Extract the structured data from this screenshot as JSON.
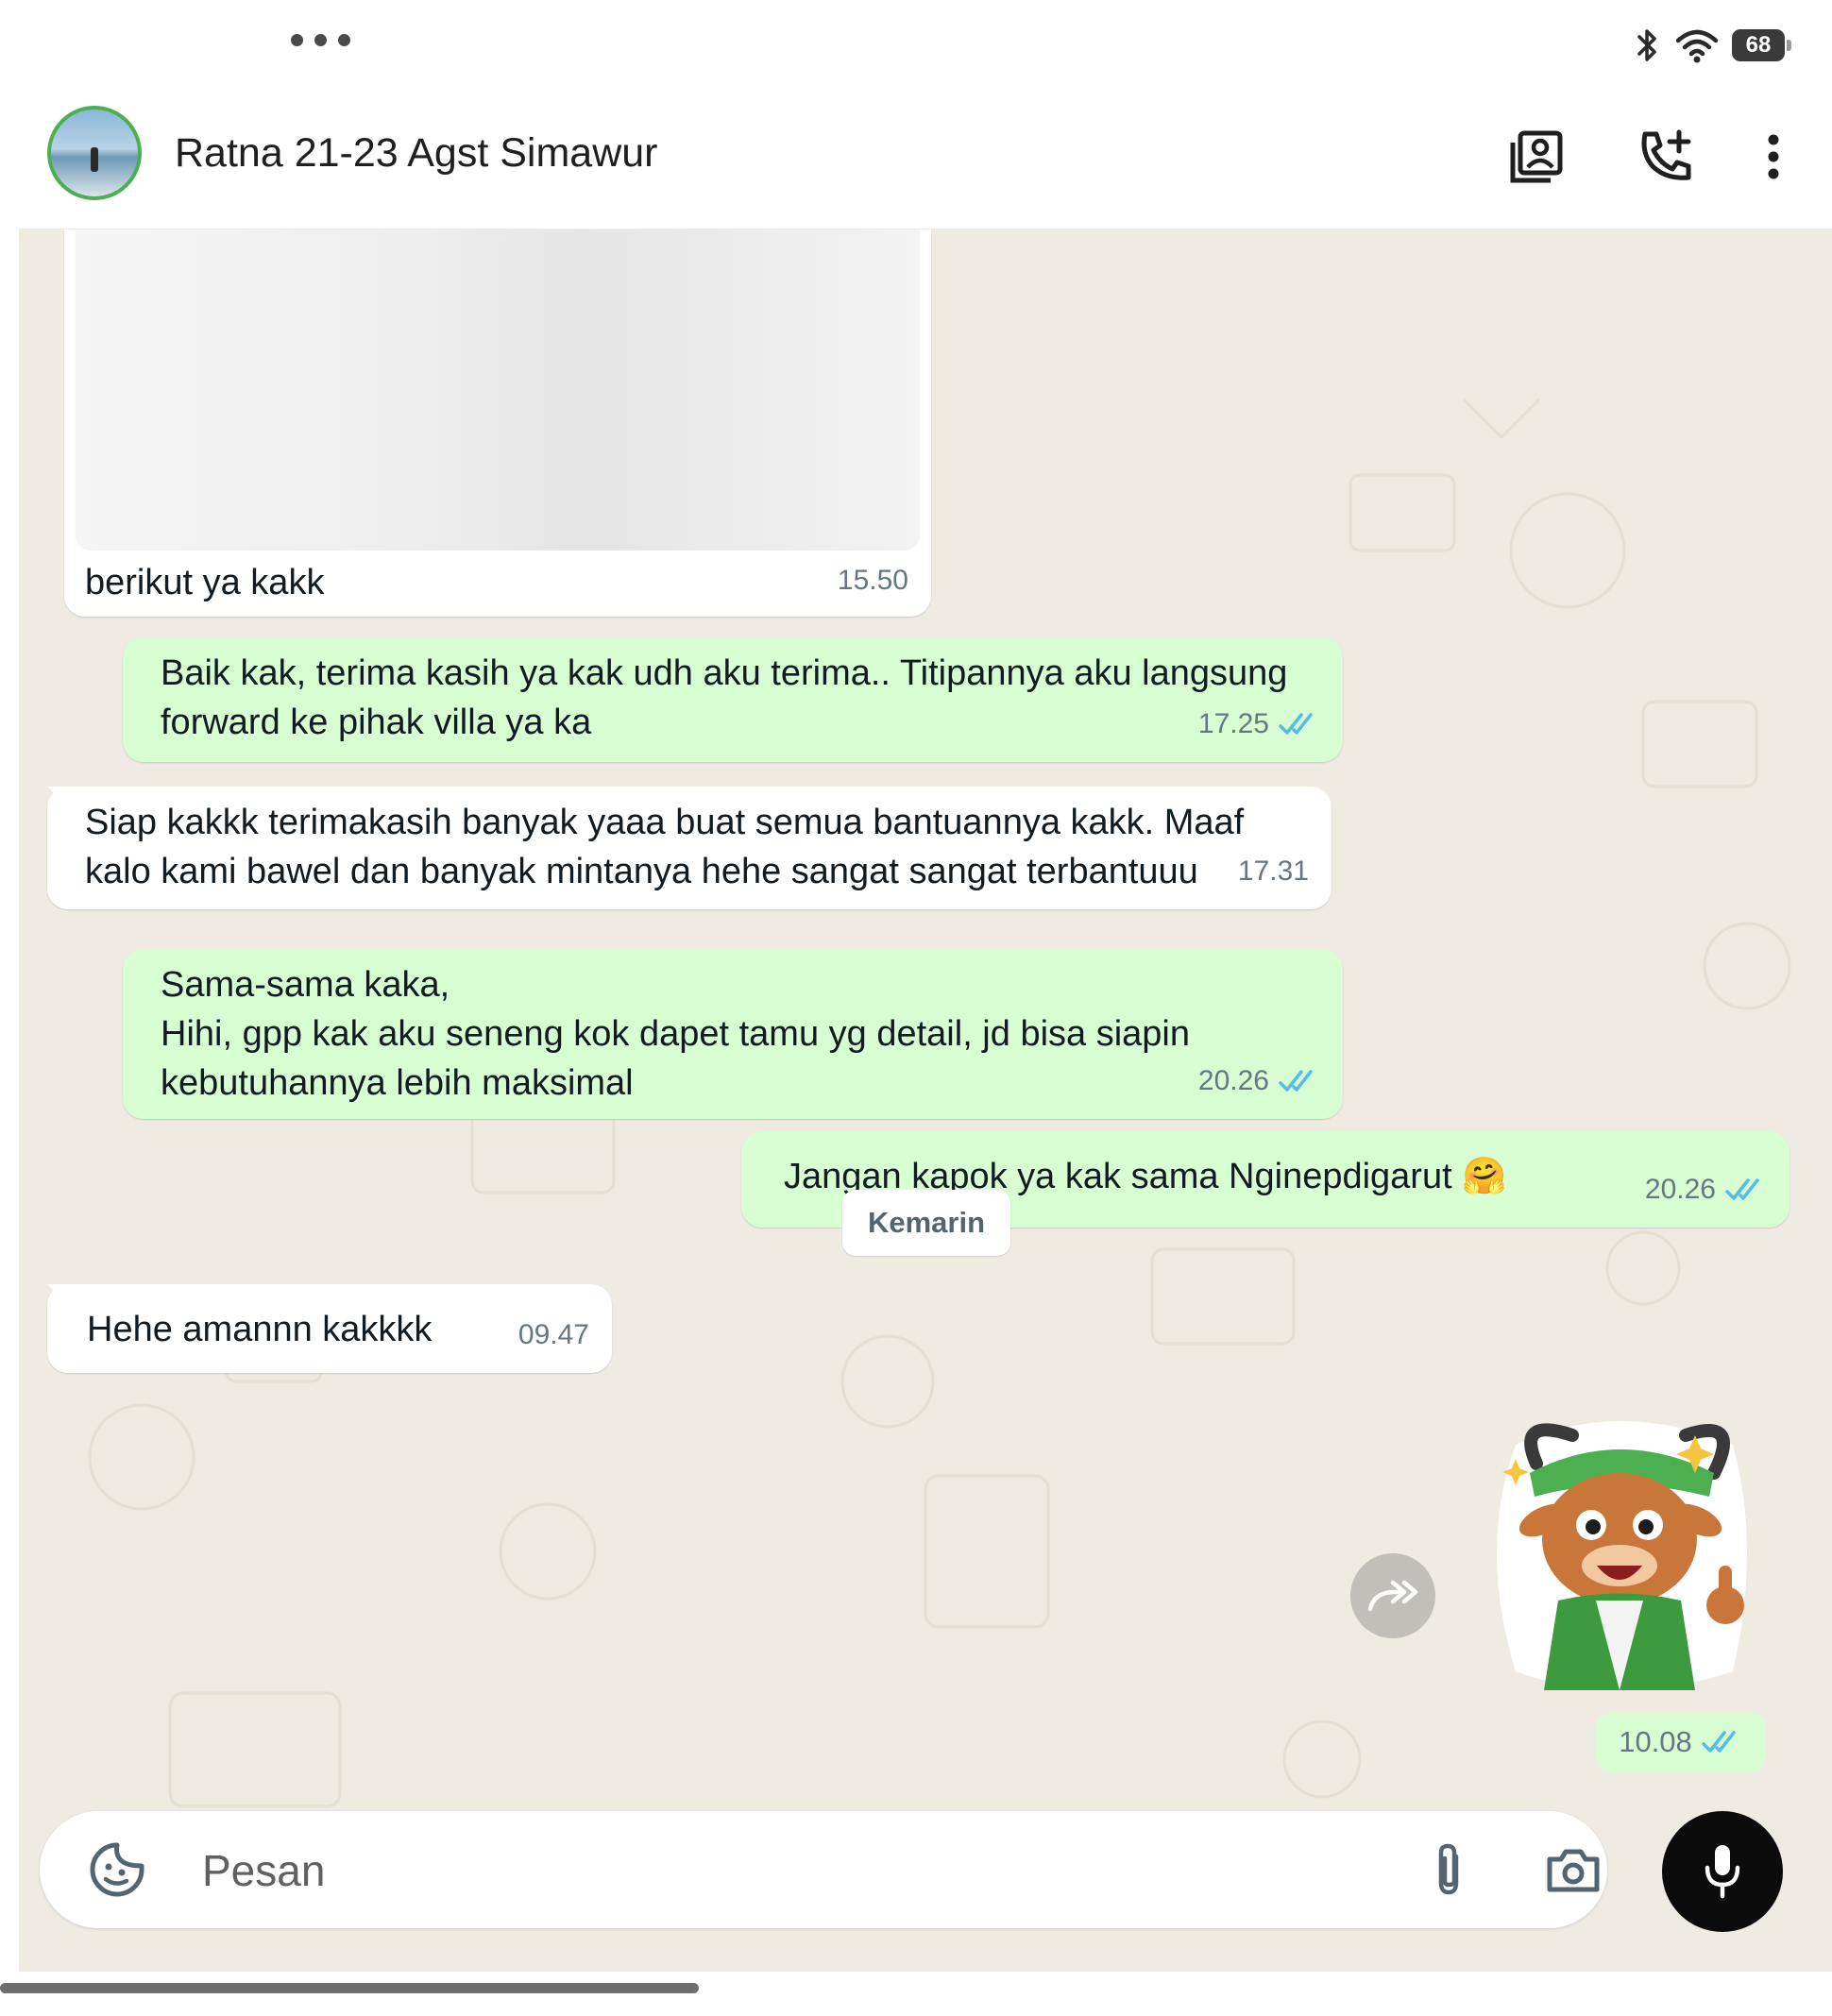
{
  "status_bar": {
    "battery": "68"
  },
  "header": {
    "contact_name": "Ratna 21-23 Agst Simawur"
  },
  "messages": [
    {
      "direction": "in",
      "text": "berikut ya kakk",
      "time": "15.50",
      "has_image": true
    },
    {
      "direction": "out",
      "text": "Baik kak, terima kasih ya kak udh aku terima.. Titipannya aku langsung forward ke pihak villa ya ka",
      "time": "17.25",
      "status": "read"
    },
    {
      "direction": "in",
      "text": "Siap kakkk terimakasih banyak yaaa buat semua bantuannya kakk. Maaf kalo kami bawel dan banyak mintanya hehe sangat sangat terbantuuu",
      "time": "17.31"
    },
    {
      "direction": "out",
      "text": "Sama-sama kaka,\nHihi, gpp kak aku seneng kok dapet tamu yg detail, jd bisa siapin kebutuhannya lebih maksimal",
      "time": "20.26",
      "status": "read"
    },
    {
      "direction": "out",
      "text": "Jangan kapok ya kak sama Nginepdigarut 🤗",
      "time": "20.26",
      "status": "read"
    },
    {
      "direction": "in",
      "text": "Hehe amannn kakkkk",
      "time": "09.47"
    },
    {
      "direction": "out",
      "type": "sticker",
      "time": "10.08",
      "status": "read"
    }
  ],
  "date_separator": "Kemarin",
  "composer": {
    "placeholder": "Pesan"
  },
  "colors": {
    "incoming_bubble": "#ffffff",
    "outgoing_bubble": "#d9fdd3",
    "chat_background": "#efeae2",
    "read_tick": "#53bdeb",
    "avatar_ring": "#4caf50"
  },
  "icons": {
    "header": [
      "contact-card-icon",
      "add-call-icon",
      "more-vert-icon"
    ],
    "composer": [
      "sticker-icon",
      "attach-icon",
      "camera-icon",
      "mic-icon"
    ],
    "chat": [
      "forward-icon",
      "double-check-icon"
    ]
  }
}
